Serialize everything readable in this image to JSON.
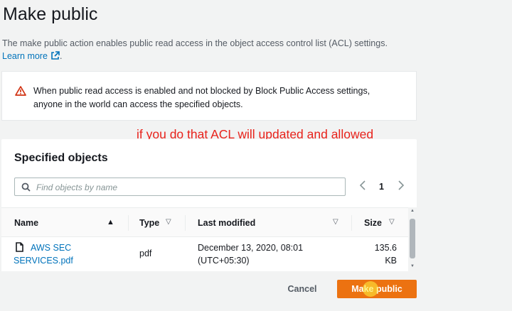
{
  "header": {
    "title": "Make public",
    "description": "The make public action enables public read access in the object access control list (ACL) settings.",
    "learn_more": "Learn more"
  },
  "warning": {
    "text_line1": "When public read access is enabled and not blocked by Block Public Access settings,",
    "text_line2": "anyone in the world can access the specified objects.",
    "icon": "warning-triangle-icon"
  },
  "annotation": "if you do that ACL will updated and allowed",
  "specified_objects": {
    "title": "Specified objects",
    "search_placeholder": "Find objects by name",
    "pagination": {
      "current_page": "1"
    },
    "columns": [
      "Name",
      "Type",
      "Last modified",
      "Size"
    ],
    "rows": [
      {
        "name_line1": "AWS SEC",
        "name_line2": "SERVICES.pdf",
        "type": "pdf",
        "modified_line1": "December 13, 2020, 08:01",
        "modified_line2": "(UTC+05:30)",
        "size_line1": "135.6",
        "size_line2": "KB"
      }
    ]
  },
  "actions": {
    "cancel": "Cancel",
    "make_public": "Make public"
  },
  "colors": {
    "primary_button": "#ec7211",
    "link": "#0073bb",
    "warning": "#d13212",
    "annotation": "#e8221b"
  }
}
